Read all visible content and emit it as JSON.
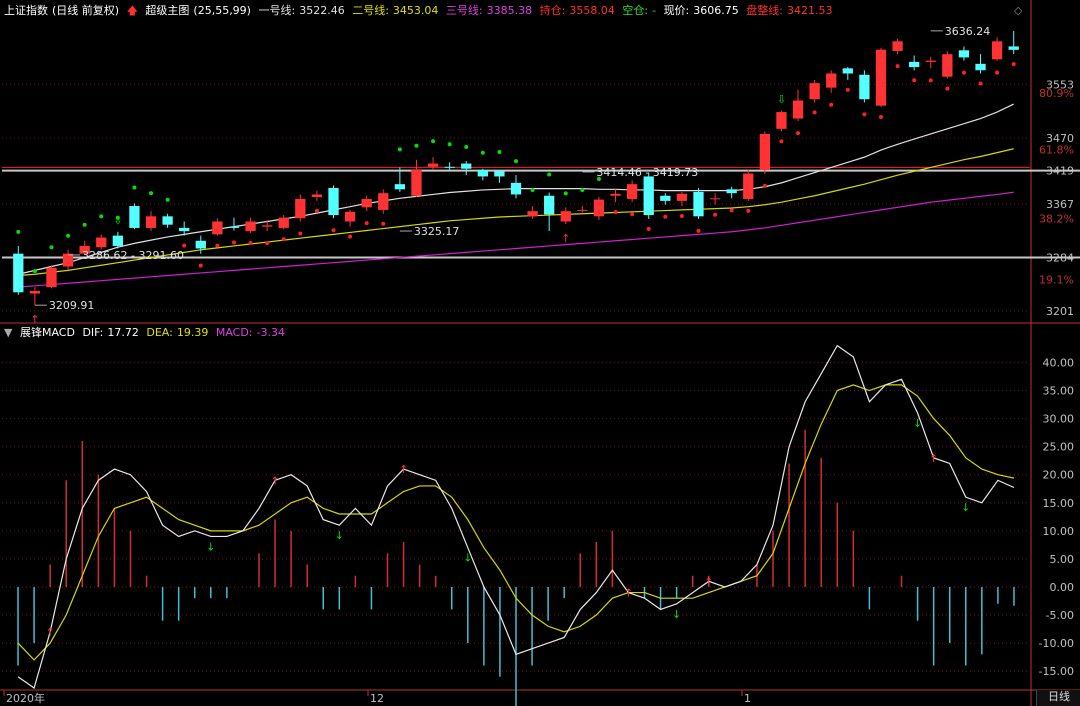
{
  "header": {
    "index_name": "上证指数",
    "period_note": "(日线 前复权)",
    "indicator_name": "超级主图",
    "indicator_params": "(25,55,99)",
    "line1_label": "一号线:",
    "line1_value": "3522.46",
    "line2_label": "二号线:",
    "line2_value": "3453.04",
    "line3_label": "三号线:",
    "line3_value": "3385.38",
    "hold_label": "持仓:",
    "hold_value": "3558.04",
    "empty_label": "空仓:",
    "empty_value": "-",
    "price_label": "现价:",
    "price_value": "3606.75",
    "consol_label": "盘整线:",
    "consol_value": "3421.53"
  },
  "macd_header": {
    "name": "展锋MACD",
    "dif_label": "DIF:",
    "dif_value": "17.72",
    "dea_label": "DEA:",
    "dea_value": "19.39",
    "macd_label": "MACD:",
    "macd_value": "-3.34"
  },
  "footer": {
    "period_button": "日线"
  },
  "colors": {
    "up": "#ff3333",
    "down": "#54ffff",
    "line1": "#e0e0e0",
    "line2": "#d8d800",
    "line3": "#d020d0",
    "green_dot": "#00e000",
    "red_dot": "#ff2020",
    "consol": "#ff2020",
    "grid": "#7a1010",
    "axis": "#c03030"
  },
  "chart_data": [
    {
      "type": "candlestick",
      "title": "上证指数 (日线 前复权)",
      "y_axis_ticks": [
        3201,
        3284,
        3367,
        3419,
        3470,
        3553
      ],
      "y_axis_pct_ticks": [
        "80.9%",
        "61.8%",
        "38.2%",
        "19.1%"
      ],
      "x_axis_ticks": [
        "2020年",
        "12",
        "1"
      ],
      "horizontal_lines": [
        3419,
        3284
      ],
      "annotations": [
        {
          "text": "3209.91",
          "index": 1,
          "value": 3209.91
        },
        {
          "text": "3286.62 - 3291.60",
          "index": 3,
          "value": 3288
        },
        {
          "text": "3325.17",
          "index": 23,
          "value": 3325.17
        },
        {
          "text": "3414.46 - 3419.73",
          "index": 34,
          "value": 3417
        },
        {
          "text": "3636.24",
          "index": 55,
          "value": 3636.24
        }
      ],
      "candles": [
        [
          3290,
          3230,
          3302,
          3226
        ],
        [
          3228,
          3232,
          3238,
          3209.91
        ],
        [
          3238,
          3268,
          3272,
          3236
        ],
        [
          3270,
          3290,
          3296,
          3265
        ],
        [
          3290,
          3302,
          3310,
          3288
        ],
        [
          3300,
          3315,
          3320,
          3296
        ],
        [
          3318,
          3302,
          3324,
          3298
        ],
        [
          3364,
          3330,
          3368,
          3328
        ],
        [
          3330,
          3348,
          3356,
          3325
        ],
        [
          3348,
          3335,
          3352,
          3330
        ],
        [
          3330,
          3325,
          3340,
          3318
        ],
        [
          3310,
          3298,
          3318,
          3290
        ],
        [
          3320,
          3340,
          3345,
          3318
        ],
        [
          3332,
          3330,
          3346,
          3326
        ],
        [
          3325,
          3340,
          3346,
          3322
        ],
        [
          3332,
          3334,
          3342,
          3325
        ],
        [
          3330,
          3346,
          3350,
          3328
        ],
        [
          3345,
          3375,
          3382,
          3340
        ],
        [
          3378,
          3382,
          3388,
          3372
        ],
        [
          3392,
          3350,
          3396,
          3345
        ],
        [
          3340,
          3355,
          3358,
          3332
        ],
        [
          3362,
          3375,
          3380,
          3356
        ],
        [
          3358,
          3384,
          3390,
          3352
        ],
        [
          3398,
          3390,
          3424,
          3386
        ],
        [
          3380,
          3421,
          3436,
          3378
        ],
        [
          3425,
          3430,
          3440,
          3420
        ],
        [
          3425,
          3424,
          3432,
          3418
        ],
        [
          3430,
          3422,
          3434,
          3412
        ],
        [
          3420,
          3410,
          3422,
          3404
        ],
        [
          3418,
          3410,
          3420,
          3400
        ],
        [
          3400,
          3382,
          3412,
          3376
        ],
        [
          3348,
          3356,
          3364,
          3344
        ],
        [
          3380,
          3351,
          3385,
          3325.17
        ],
        [
          3340,
          3356,
          3362,
          3336
        ],
        [
          3358,
          3358,
          3364,
          3354
        ],
        [
          3348,
          3374,
          3378,
          3342
        ],
        [
          3380,
          3383,
          3390,
          3370
        ],
        [
          3375,
          3398,
          3404,
          3370
        ],
        [
          3410,
          3350,
          3416,
          3344
        ],
        [
          3380,
          3372,
          3384,
          3366
        ],
        [
          3372,
          3383,
          3386,
          3364
        ],
        [
          3386,
          3348,
          3392,
          3344
        ],
        [
          3375,
          3376,
          3384,
          3366
        ],
        [
          3390,
          3384,
          3394,
          3376
        ],
        [
          3375,
          3414.46,
          3420,
          3372
        ],
        [
          3420,
          3476,
          3480,
          3414
        ],
        [
          3484,
          3510,
          3512,
          3480
        ],
        [
          3500,
          3528,
          3545,
          3496
        ],
        [
          3530,
          3555,
          3560,
          3525
        ],
        [
          3548,
          3570,
          3575,
          3540
        ],
        [
          3578,
          3570,
          3580,
          3560
        ],
        [
          3568,
          3530,
          3575,
          3525
        ],
        [
          3520,
          3607,
          3610,
          3518
        ],
        [
          3605,
          3620,
          3624,
          3600
        ],
        [
          3588,
          3580,
          3598,
          3575
        ],
        [
          3588,
          3590,
          3596,
          3578
        ],
        [
          3565,
          3600,
          3605,
          3562
        ],
        [
          3606,
          3595,
          3612,
          3590
        ],
        [
          3585,
          3575,
          3600,
          3570
        ],
        [
          3592,
          3620,
          3626,
          3590
        ],
        [
          3612,
          3606.75,
          3636.24,
          3600
        ]
      ],
      "series": [
        {
          "name": "一号线",
          "values": [
            3258,
            3264,
            3270,
            3276,
            3284,
            3292,
            3300,
            3306,
            3311,
            3316,
            3320,
            3324,
            3328,
            3332,
            3336,
            3340,
            3344,
            3348,
            3353,
            3358,
            3363,
            3368,
            3372,
            3376,
            3379,
            3382,
            3385,
            3387,
            3389,
            3390,
            3391,
            3391,
            3391,
            3391,
            3391,
            3390,
            3390,
            3389,
            3389,
            3388,
            3388,
            3388,
            3388,
            3388,
            3390,
            3394,
            3400,
            3408,
            3416,
            3424,
            3432,
            3440,
            3451,
            3460,
            3468,
            3476,
            3484,
            3492,
            3500,
            3510,
            3522.46
          ]
        },
        {
          "name": "二号线",
          "values": [
            3256,
            3258,
            3261,
            3264,
            3268,
            3272,
            3276,
            3280,
            3284,
            3288,
            3292,
            3296,
            3299,
            3302,
            3305,
            3308,
            3311,
            3314,
            3317,
            3320,
            3323,
            3326,
            3329,
            3332,
            3335,
            3338,
            3341,
            3343,
            3345,
            3347,
            3348,
            3349,
            3350,
            3351,
            3352,
            3353,
            3354,
            3355,
            3356,
            3357,
            3358,
            3359,
            3360,
            3361,
            3363,
            3366,
            3370,
            3375,
            3380,
            3386,
            3392,
            3398,
            3405,
            3412,
            3418,
            3424,
            3430,
            3436,
            3441,
            3447,
            3453.04
          ]
        },
        {
          "name": "三号线",
          "values": [
            3238,
            3240,
            3242,
            3244,
            3246,
            3248,
            3250,
            3252,
            3254,
            3256,
            3258,
            3260,
            3262,
            3264,
            3266,
            3268,
            3270,
            3272,
            3274,
            3276,
            3278,
            3280,
            3282,
            3284,
            3286,
            3288,
            3290,
            3292,
            3294,
            3296,
            3298,
            3300,
            3302,
            3304,
            3306,
            3308,
            3310,
            3312,
            3314,
            3316,
            3318,
            3320,
            3322,
            3324,
            3327,
            3330,
            3334,
            3338,
            3342,
            3346,
            3350,
            3354,
            3358,
            3362,
            3366,
            3370,
            3373,
            3376,
            3379,
            3382,
            3385.38
          ]
        }
      ],
      "markers": [
        {
          "type": "green_arrow_down",
          "index": 6
        },
        {
          "type": "red_arrow_up",
          "index": 1
        },
        {
          "type": "red_arrow_up",
          "index": 33
        },
        {
          "type": "green_arrow_down",
          "index": 46
        }
      ]
    },
    {
      "type": "macd",
      "title": "展锋MACD",
      "y_axis_ticks": [
        40,
        35,
        30,
        25,
        20,
        15,
        10,
        5,
        0,
        -5,
        -10,
        -15
      ],
      "DIF": [
        -16,
        -18,
        -8,
        5,
        14,
        19,
        21,
        20,
        17,
        11,
        9,
        10,
        9,
        9,
        10,
        14,
        19,
        20,
        18,
        12,
        11,
        14,
        11,
        18,
        21,
        20,
        19,
        14,
        7,
        0,
        -5,
        -12,
        -11,
        -10,
        -9,
        -4,
        -1,
        3,
        -1,
        -2,
        -4,
        -3,
        -1,
        1,
        0,
        1,
        4,
        11,
        25,
        33,
        38,
        43,
        41,
        33,
        36,
        37,
        31,
        23,
        22,
        16,
        15,
        19,
        17.72
      ],
      "DEA": [
        -10,
        -13,
        -10,
        -5,
        2,
        9,
        14,
        15,
        16,
        14,
        12,
        11,
        10,
        10,
        10,
        11,
        13,
        15,
        16,
        14,
        13,
        13,
        13,
        15,
        17,
        18,
        18,
        16,
        12,
        7,
        3,
        -2,
        -5,
        -7,
        -8,
        -7,
        -5,
        -2,
        -1,
        -1,
        -2,
        -2,
        -2,
        -1,
        0,
        1,
        2,
        6,
        14,
        22,
        29,
        35,
        36,
        35,
        36,
        36,
        34,
        30,
        27,
        23,
        21,
        20,
        19.39
      ],
      "MACD": [
        -14,
        -10,
        4,
        19,
        26,
        20,
        14,
        10,
        2,
        -6,
        -6,
        -2,
        -2,
        -2,
        0,
        6,
        12,
        10,
        4,
        -4,
        -4,
        2,
        -4,
        6,
        8,
        4,
        2,
        -4,
        -10,
        -14,
        -16,
        -22,
        -14,
        -6,
        -2,
        6,
        8,
        10,
        0,
        -2,
        -4,
        -2,
        2,
        2,
        0,
        0,
        4,
        10,
        22,
        28,
        23,
        15,
        10,
        -4,
        0,
        2,
        -6,
        -14,
        -10,
        -14,
        -12,
        -3,
        -3.34
      ],
      "markers": [
        {
          "type": "red_arrow_up",
          "index": 2
        },
        {
          "type": "green_arrow_down",
          "index": 12
        },
        {
          "type": "red_arrow_up",
          "index": 16
        },
        {
          "type": "green_arrow_down",
          "index": 20
        },
        {
          "type": "red_arrow_up",
          "index": 24
        },
        {
          "type": "green_arrow_down",
          "index": 28
        },
        {
          "type": "red_arrow_up",
          "index": 38
        },
        {
          "type": "green_arrow_down",
          "index": 41
        },
        {
          "type": "red_arrow_up",
          "index": 43
        },
        {
          "type": "green_arrow_down",
          "index": 56
        },
        {
          "type": "red_arrow_up",
          "index": 57
        },
        {
          "type": "green_arrow_down",
          "index": 59
        }
      ]
    }
  ]
}
